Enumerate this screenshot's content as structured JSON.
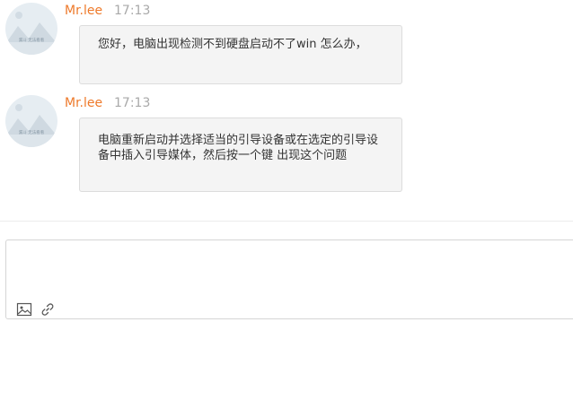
{
  "messages": [
    {
      "sender": "Mr.lee",
      "time": "17:13",
      "avatar_text": "漏斗 无法看看",
      "text": "您好，电脑出现检测不到硬盘启动不了win 怎么办，"
    },
    {
      "sender": "Mr.lee",
      "time": "17:13",
      "avatar_text": "漏斗 无法看看",
      "text": "电脑重新启动并选择适当的引导设备或在选定的引导设备中插入引导媒体，然后按一个键 出现这个问题"
    }
  ],
  "composer": {
    "placeholder": "",
    "tools": [
      "image-icon",
      "link-icon"
    ]
  },
  "colors": {
    "name": "#ee7a2b",
    "time": "#a9a9a9",
    "bubble_bg": "#f4f4f4",
    "bubble_border": "#dcdcdc"
  }
}
